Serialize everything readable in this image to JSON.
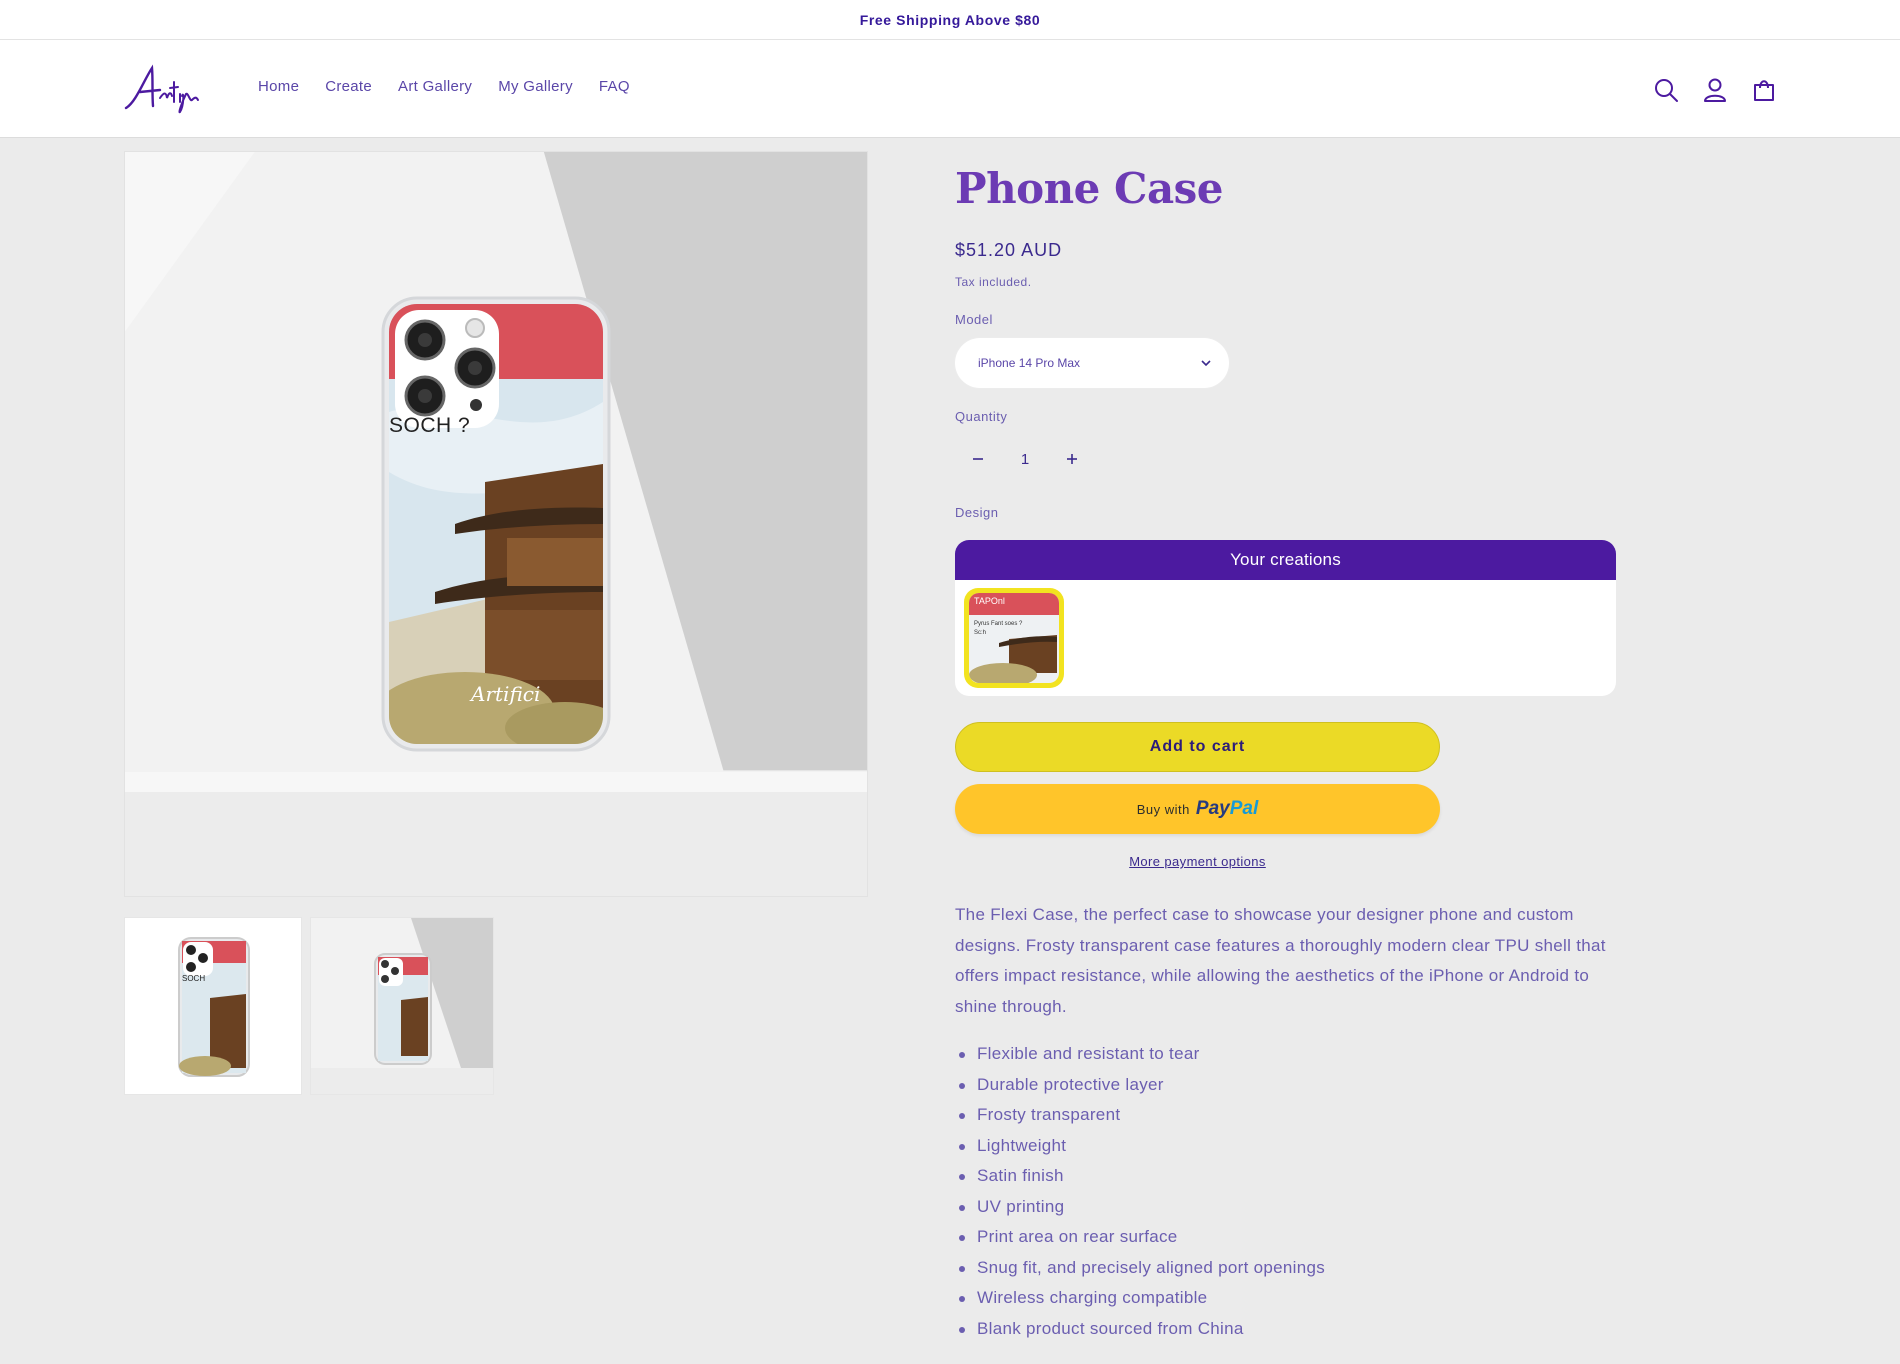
{
  "announcement": {
    "text": "Free Shipping Above $80"
  },
  "brand": {
    "logo_text": "Artifici",
    "accent": "#4c1aa0",
    "button_yellow": "#ebda26",
    "paypal_yellow": "#ffc52a"
  },
  "nav": {
    "items": [
      {
        "label": "Home"
      },
      {
        "label": "Create"
      },
      {
        "label": "Art Gallery"
      },
      {
        "label": "My Gallery"
      },
      {
        "label": "FAQ"
      }
    ]
  },
  "header_icons": [
    "search-icon",
    "account-icon",
    "cart-icon"
  ],
  "gallery": {
    "phone_overlay_text": "SOCH ?",
    "case_signature": "Artifici",
    "thumbnail_overlay_text": "SOCH"
  },
  "product": {
    "title": "Phone Case",
    "price": "$51.20 AUD",
    "tax_note": "Tax included.",
    "model_label": "Model",
    "model_value": "iPhone 14 Pro Max",
    "quantity_label": "Quantity",
    "quantity_value": "1",
    "design_label": "Design",
    "creations_header": "Your creations",
    "creation_tile": {
      "title": "TAPOnl",
      "subtitle": "Pyrus Fant soes ?",
      "caption": "Sc:h"
    },
    "add_to_cart": "Add to cart",
    "paypal": {
      "prefix": "Buy with",
      "brand_part1": "Pay",
      "brand_part2": "Pal"
    },
    "more_payment": "More payment options",
    "description": "The Flexi Case, the perfect case to showcase your designer phone and custom designs. Frosty transparent case features a thoroughly modern clear TPU shell that offers impact resistance, while allowing the aesthetics of the iPhone or Android to shine through.",
    "features": [
      "Flexible and resistant to tear",
      "Durable protective layer",
      "Frosty transparent",
      "Lightweight",
      "Satin finish",
      "UV printing",
      "Print area on rear surface",
      "Snug fit, and precisely aligned port openings",
      "Wireless charging compatible",
      "Blank product sourced from China"
    ]
  }
}
